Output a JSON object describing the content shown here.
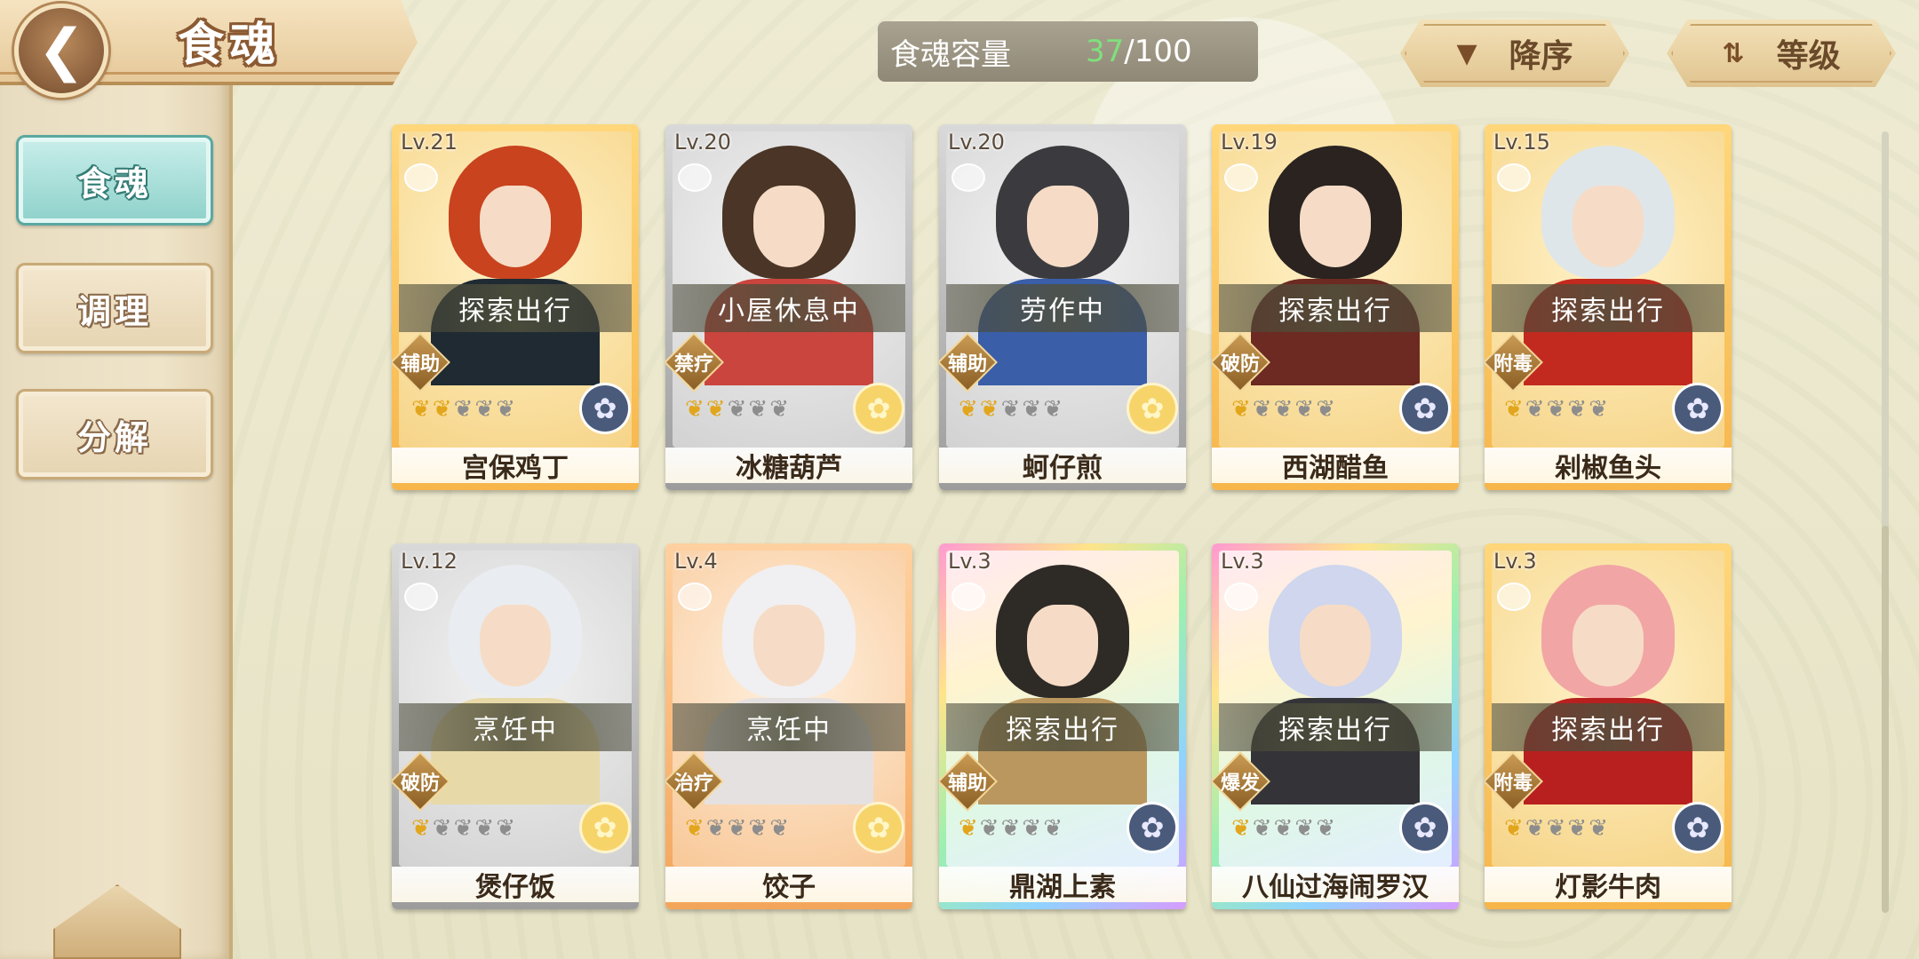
{
  "header": {
    "title": "食魂",
    "back_icon": "chevron-left-icon"
  },
  "sidebar": {
    "items": [
      {
        "label": "食魂",
        "active": true
      },
      {
        "label": "调理",
        "active": false
      },
      {
        "label": "分解",
        "active": false
      }
    ]
  },
  "capacity": {
    "label": "食魂容量",
    "current": "37",
    "max": "/100",
    "current_color": "#7fe07c"
  },
  "sort": {
    "order_label": "降序",
    "order_icon": "triangle-down-icon",
    "field_label": "等级",
    "field_icon": "swap-icon"
  },
  "colors": {
    "accent_teal": "#8ed1ca",
    "flame_on": "#e2a61c",
    "flame_off": "#8d8d8d"
  },
  "cards": [
    {
      "lv": "Lv.21",
      "status": "探索出行",
      "role": "辅助",
      "name": "宫保鸡丁",
      "stars": 2,
      "rarity": "gold",
      "emblem": "blue",
      "hair": "#c8431e",
      "robe": "#1f2a33"
    },
    {
      "lv": "Lv.20",
      "status": "小屋休息中",
      "role": "禁疗",
      "name": "冰糖葫芦",
      "stars": 2,
      "rarity": "silver",
      "emblem": "yellow",
      "hair": "#4a3526",
      "robe": "#c9453d"
    },
    {
      "lv": "Lv.20",
      "status": "劳作中",
      "role": "辅助",
      "name": "蚵仔煎",
      "stars": 2,
      "rarity": "silver",
      "emblem": "yellow",
      "hair": "#3b3b3f",
      "robe": "#3a5ea8"
    },
    {
      "lv": "Lv.19",
      "status": "探索出行",
      "role": "破防",
      "name": "西湖醋鱼",
      "stars": 1,
      "rarity": "gold",
      "emblem": "blue",
      "hair": "#2a2320",
      "robe": "#6c2a22"
    },
    {
      "lv": "Lv.15",
      "status": "探索出行",
      "role": "附毒",
      "name": "剁椒鱼头",
      "stars": 1,
      "rarity": "gold",
      "emblem": "blue",
      "hair": "#dfe6ea",
      "robe": "#c22a1f"
    },
    {
      "lv": "Lv.12",
      "status": "烹饪中",
      "role": "破防",
      "name": "煲仔饭",
      "stars": 1,
      "rarity": "silver",
      "emblem": "yellow",
      "hair": "#e9ecf0",
      "robe": "#e8d9a8"
    },
    {
      "lv": "Lv.4",
      "status": "烹饪中",
      "role": "治疗",
      "name": "饺子",
      "stars": 1,
      "rarity": "orange",
      "emblem": "yellow",
      "hair": "#f0f0f2",
      "robe": "#e6e1e1"
    },
    {
      "lv": "Lv.3",
      "status": "探索出行",
      "role": "辅助",
      "name": "鼎湖上素",
      "stars": 1,
      "rarity": "rainbow",
      "emblem": "blue",
      "hair": "#2e2a26",
      "robe": "#b9975e"
    },
    {
      "lv": "Lv.3",
      "status": "探索出行",
      "role": "爆发",
      "name": "八仙过海闹罗汉",
      "stars": 1,
      "rarity": "rainbow",
      "emblem": "blue",
      "hair": "#cfd6ee",
      "robe": "#343438"
    },
    {
      "lv": "Lv.3",
      "status": "探索出行",
      "role": "附毒",
      "name": "灯影牛肉",
      "stars": 1,
      "rarity": "gold",
      "emblem": "blue",
      "hair": "#f2a5a5",
      "robe": "#b82020"
    }
  ]
}
